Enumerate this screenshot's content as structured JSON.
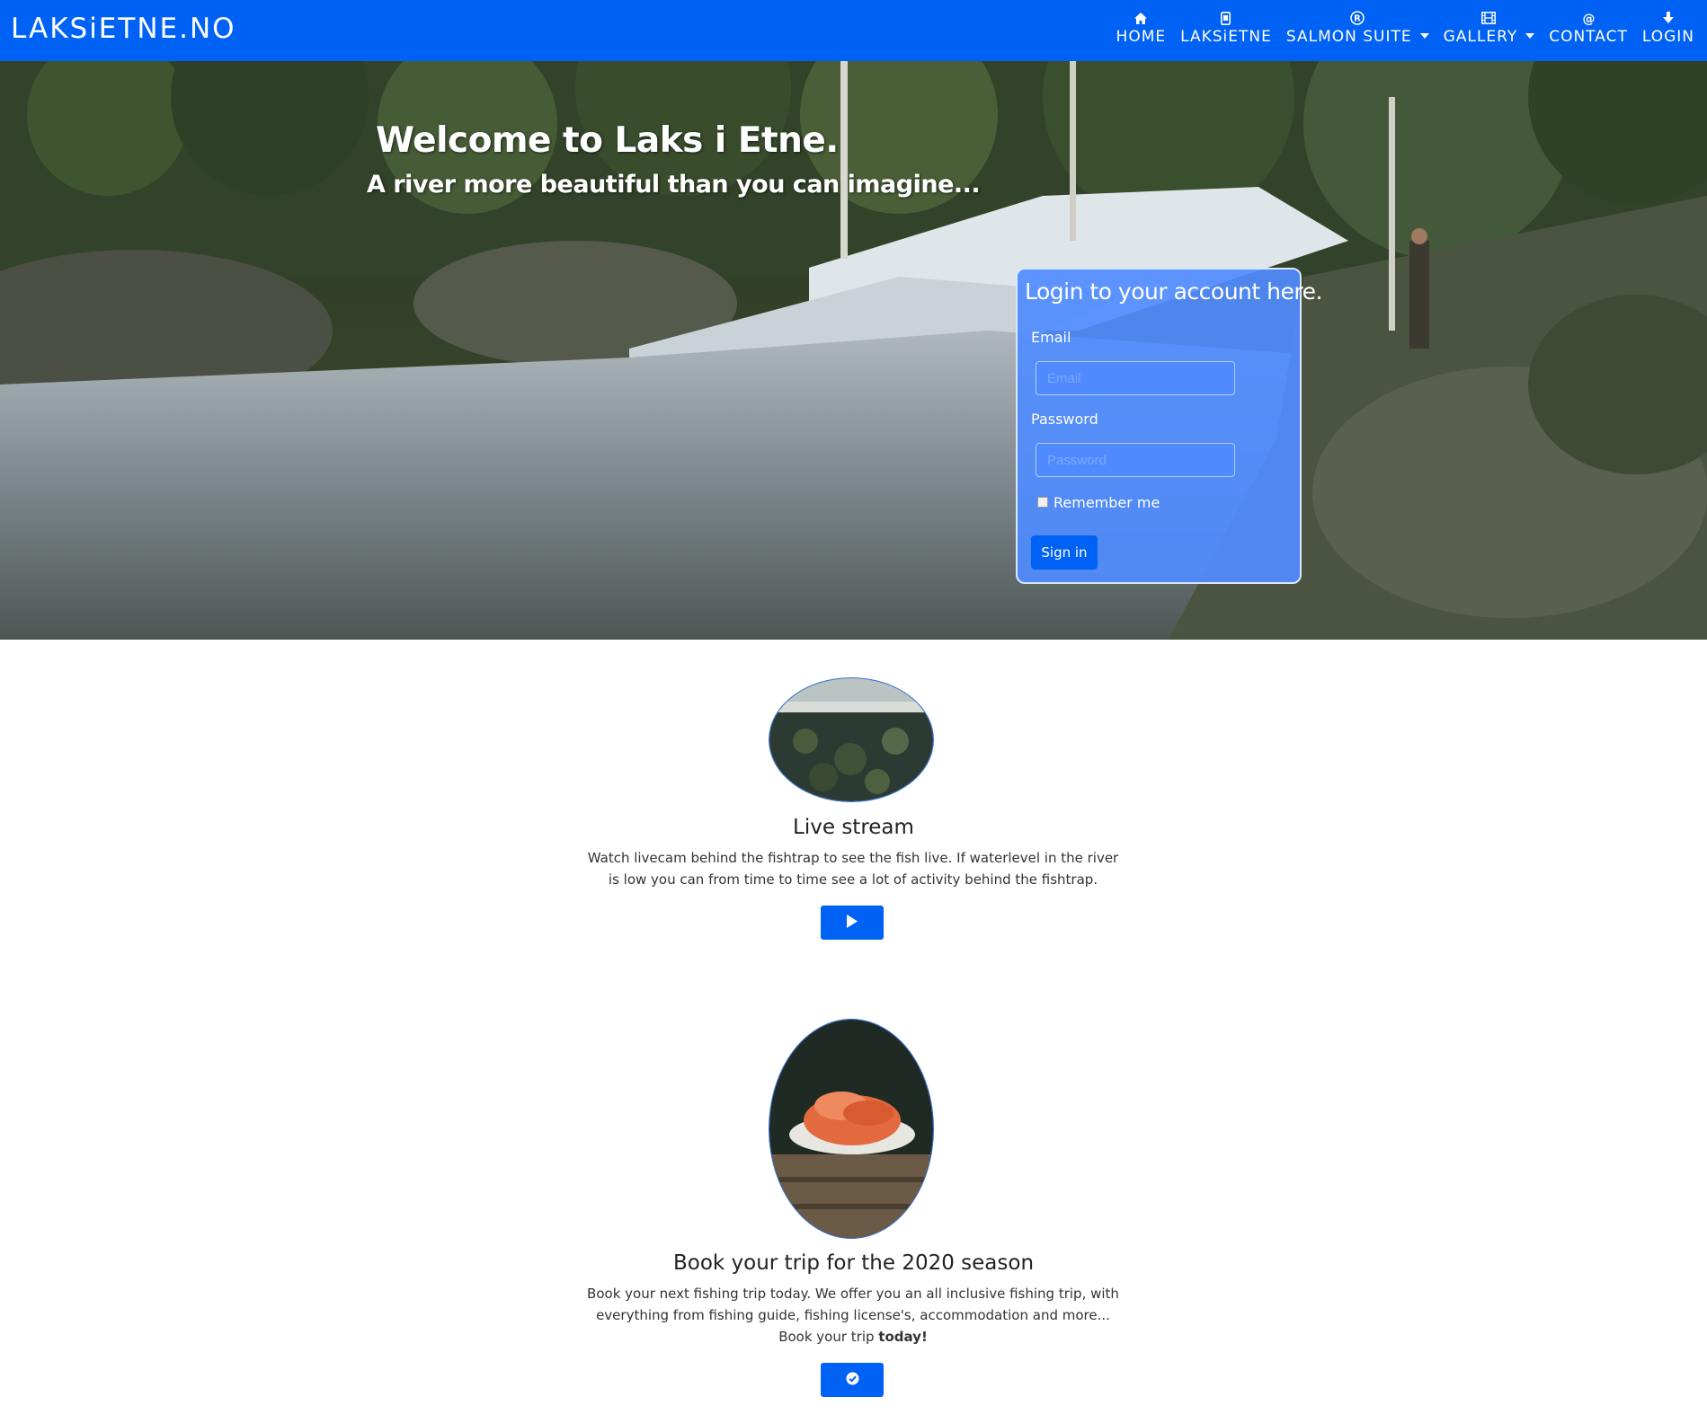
{
  "navbar": {
    "brand": "LAKSiETNE.NO",
    "items": [
      {
        "label": "HOME",
        "icon": "home-icon"
      },
      {
        "label": "LAKSiETNE",
        "icon": "phone-icon"
      },
      {
        "label": "SALMON SUITE",
        "icon": "registered-icon",
        "dropdown": true
      },
      {
        "label": "GALLERY",
        "icon": "film-icon",
        "dropdown": true
      },
      {
        "label": "CONTACT",
        "icon": "at-icon"
      },
      {
        "label": "LOGIN",
        "icon": "arrow-down-icon"
      }
    ]
  },
  "hero": {
    "title": "Welcome to Laks i Etne.",
    "subtitle": "A river more beautiful than you can imagine..."
  },
  "login": {
    "title": "Login to your account here.",
    "email_label": "Email",
    "email_placeholder": "Email",
    "password_label": "Password",
    "password_placeholder": "Password",
    "remember_label": "Remember me",
    "submit_label": "Sign in"
  },
  "features": [
    {
      "title": "Live stream",
      "text": "Watch livecam behind the fishtrap to see the fish live. If waterlevel in the river is low you can from time to time see a lot of activity behind the fishtrap.",
      "button_icon": "play-icon"
    },
    {
      "title": "Book your trip for the 2020 season",
      "text_line1": "Book your next fishing trip today. We offer you an all inclusive fishing trip, with everything from fishing guide, fishing license's, accommodation and more...",
      "text_line2_prefix": "Book your trip ",
      "text_line2_bold": "today!",
      "button_icon": "check-circle-icon"
    }
  ],
  "colors": {
    "primary": "#0062f5",
    "login_card": "#508cff"
  }
}
